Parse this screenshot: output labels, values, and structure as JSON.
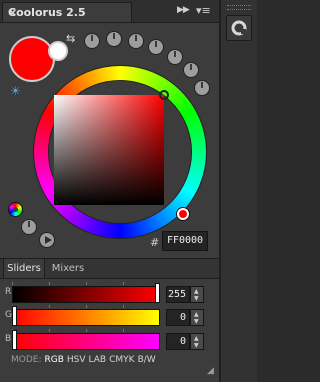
{
  "panel": {
    "title": "Coolorus 2.5",
    "close_glyph": "×",
    "fast_forward_glyph": "▶▶",
    "menu_glyph": "▾≡"
  },
  "dock": {
    "icon": "coolorus-ring-icon"
  },
  "colors": {
    "foreground": "#ff0000",
    "background": "#ffffff",
    "accent": "#4fa8e0"
  },
  "hex": {
    "hash": "#",
    "value": "FF0000"
  },
  "tabs": [
    {
      "label": "Sliders",
      "active": true
    },
    {
      "label": "Mixers",
      "active": false
    }
  ],
  "sliders": [
    {
      "label": "R",
      "value": "255",
      "fraction": 1.0,
      "from": "#000000",
      "to": "#ff0000"
    },
    {
      "label": "G",
      "value": "0",
      "fraction": 0.0,
      "from": "#ff0000",
      "to": "#ffff00"
    },
    {
      "label": "B",
      "value": "0",
      "fraction": 0.0,
      "from": "#ff0000",
      "to": "#ff00ff"
    }
  ],
  "mode": {
    "label": "MODE:",
    "options": [
      "RGB",
      "HSV",
      "LAB",
      "CMYK",
      "B/W"
    ],
    "active": "RGB"
  },
  "icons": {
    "swap": "swap-colors-icon",
    "light": "light-icon",
    "mini_wheel": "mini-color-wheel-icon",
    "play": "play-icon"
  }
}
